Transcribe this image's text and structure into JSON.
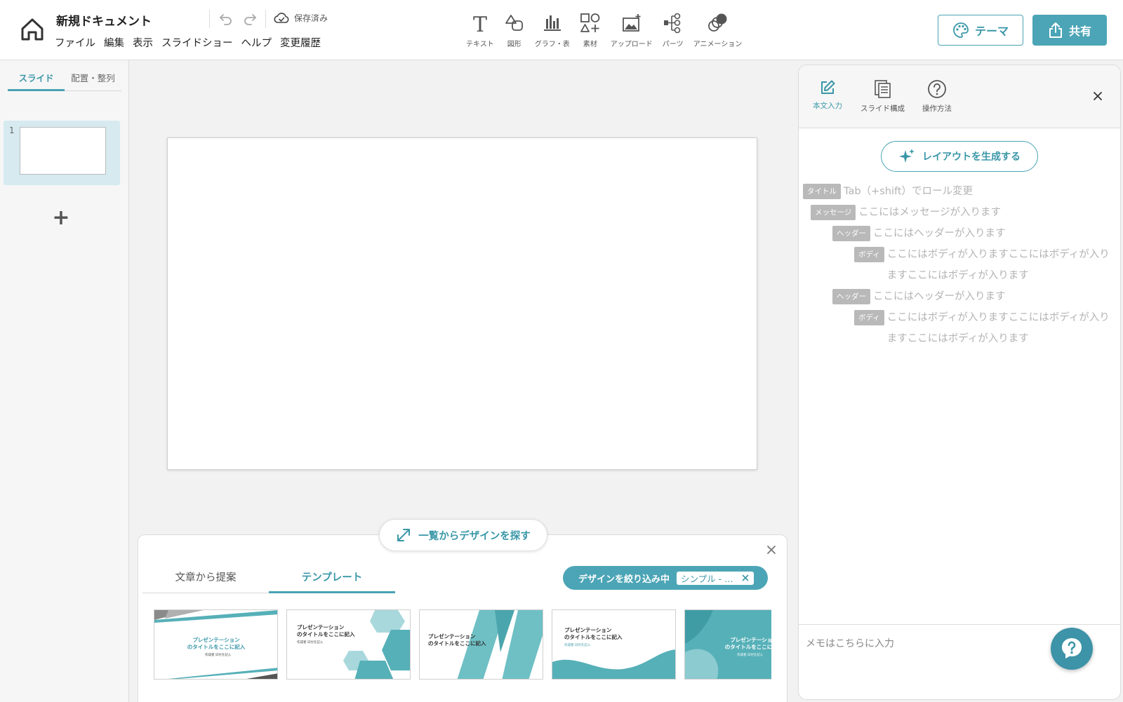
{
  "header": {
    "doc_title": "新規ドキュメント",
    "save_status": "保存済み",
    "menu": [
      "ファイル",
      "編集",
      "表示",
      "スライドショー",
      "ヘルプ",
      "変更履歴"
    ],
    "tools": [
      {
        "label": "テキスト",
        "icon": "text-icon"
      },
      {
        "label": "図形",
        "icon": "shape-icon"
      },
      {
        "label": "グラフ・表",
        "icon": "chart-icon"
      },
      {
        "label": "素材",
        "icon": "material-icon"
      },
      {
        "label": "アップロード",
        "icon": "upload-image-icon"
      },
      {
        "label": "パーツ",
        "icon": "parts-icon"
      },
      {
        "label": "アニメーション",
        "icon": "animation-icon"
      }
    ],
    "theme_label": "テーマ",
    "share_label": "共有"
  },
  "left_panel": {
    "tabs": [
      "スライド",
      "配置・整列"
    ],
    "slides": [
      {
        "number": "1"
      }
    ],
    "add_label": "+"
  },
  "design_panel": {
    "explore_label": "一覧からデザインを探す",
    "tabs": [
      "文章から提案",
      "テンプレート"
    ],
    "filter_label": "デザインを絞り込み中",
    "filter_chip": "シンプル - …",
    "templates": [
      {
        "title_line1": "プレゼンテーション",
        "title_line2": "のタイトルをここに記入",
        "sub": "作成者 日付を記入"
      },
      {
        "title_line1": "プレゼンテーション",
        "title_line2": "のタイトルをここに記入",
        "sub": "作成者 日付を記入"
      },
      {
        "title_line1": "プレゼンテーション",
        "title_line2": "のタイトルをここに記入",
        "sub": ""
      },
      {
        "title_line1": "プレゼンテーション",
        "title_line2": "のタイトルをここに記入",
        "sub": "作成者 日付を記入"
      },
      {
        "title_line1": "プレゼンテーション",
        "title_line2": "のタイトルをここに記入",
        "sub": "作成者 日付を記入"
      }
    ]
  },
  "right_panel": {
    "tabs": [
      {
        "label": "本文入力",
        "icon": "edit-icon"
      },
      {
        "label": "スライド構成",
        "icon": "slides-structure-icon"
      },
      {
        "label": "操作方法",
        "icon": "help-circle-icon"
      }
    ],
    "generate_label": "レイアウトを生成する",
    "outline": [
      {
        "role": "タイトル",
        "text": "Tab（+shift）でロール変更"
      },
      {
        "role": "メッセージ",
        "text": "ここにはメッセージが入ります"
      },
      {
        "role": "ヘッダー",
        "text": "ここにはヘッダーが入ります"
      },
      {
        "role": "ボディ",
        "text": "ここにはボディが入りますここにはボディが入りますここにはボディが入ります"
      },
      {
        "role": "ヘッダー",
        "text": "ここにはヘッダーが入ります"
      },
      {
        "role": "ボディ",
        "text": "ここにはボディが入りますここにはボディが入りますここにはボディが入ります"
      }
    ],
    "memo_placeholder": "メモはこちらに入力"
  },
  "colors": {
    "accent": "#4ca5b6",
    "accent_text": "#3a97a8",
    "template_teal": "#56b0b8",
    "template_teal_light": "#a8d8dc",
    "role_badge": "#b9b9b9"
  }
}
